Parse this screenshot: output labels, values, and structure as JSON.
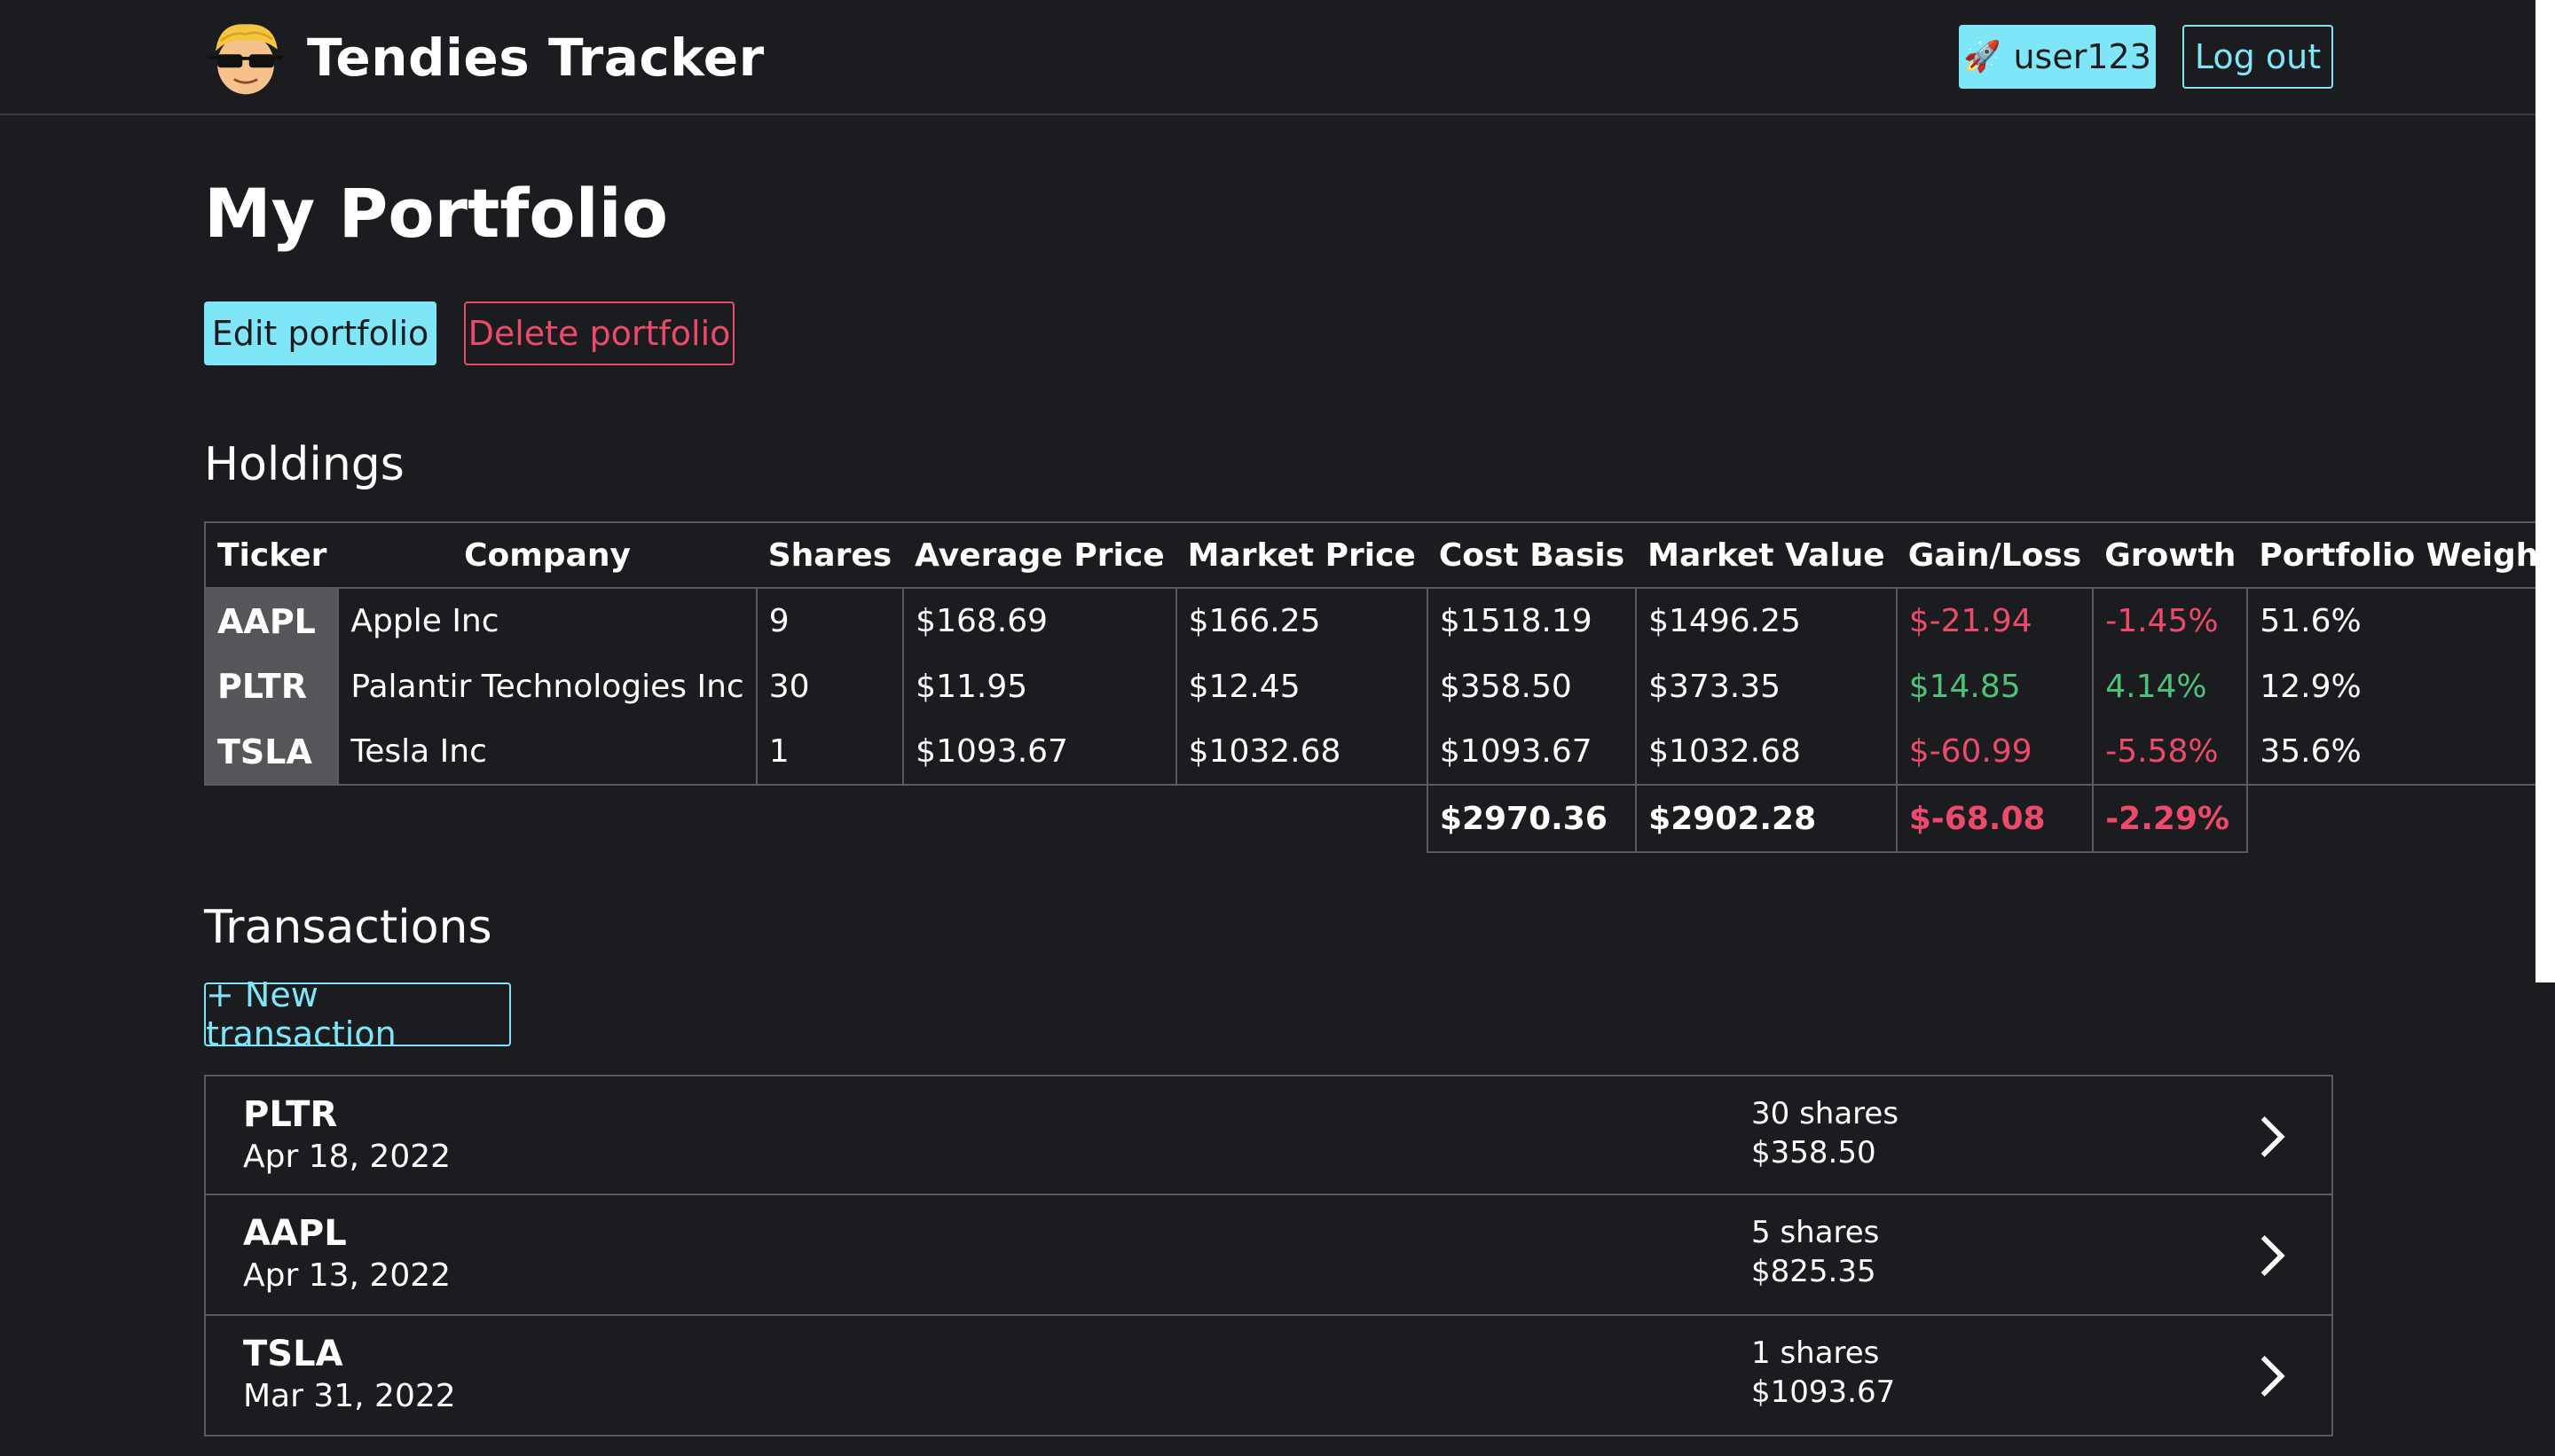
{
  "header": {
    "brand": "Tendies Tracker",
    "logo_icon": "wsb-mascot-icon",
    "user_icon": "rocket-icon",
    "user_label": "user123",
    "logout_label": "Log out"
  },
  "page": {
    "title": "My Portfolio",
    "edit_label": "Edit portfolio",
    "delete_label": "Delete portfolio"
  },
  "holdings": {
    "title": "Holdings",
    "columns": [
      "Ticker",
      "Company",
      "Shares",
      "Average Price",
      "Market Price",
      "Cost Basis",
      "Market Value",
      "Gain/Loss",
      "Growth",
      "Portfolio Weight"
    ],
    "rows": [
      {
        "ticker": "AAPL",
        "company": "Apple Inc",
        "shares": "9",
        "avg_price": "$168.69",
        "market_price": "$166.25",
        "cost_basis": "$1518.19",
        "market_value": "$1496.25",
        "gain_loss": "$-21.94",
        "growth": "-1.45%",
        "weight": "51.6%"
      },
      {
        "ticker": "PLTR",
        "company": "Palantir Technologies Inc",
        "shares": "30",
        "avg_price": "$11.95",
        "market_price": "$12.45",
        "cost_basis": "$358.50",
        "market_value": "$373.35",
        "gain_loss": "$14.85",
        "growth": "4.14%",
        "weight": "12.9%"
      },
      {
        "ticker": "TSLA",
        "company": "Tesla Inc",
        "shares": "1",
        "avg_price": "$1093.67",
        "market_price": "$1032.68",
        "cost_basis": "$1093.67",
        "market_value": "$1032.68",
        "gain_loss": "$-60.99",
        "growth": "-5.58%",
        "weight": "35.6%"
      }
    ],
    "totals": {
      "cost_basis": "$2970.36",
      "market_value": "$2902.28",
      "gain_loss": "$-68.08",
      "growth": "-2.29%"
    }
  },
  "transactions": {
    "title": "Transactions",
    "new_label": "+ New transaction",
    "items": [
      {
        "ticker": "PLTR",
        "date": "Apr 18, 2022",
        "shares": "30 shares",
        "amount": "$358.50"
      },
      {
        "ticker": "AAPL",
        "date": "Apr 13, 2022",
        "shares": "5 shares",
        "amount": "$825.35"
      },
      {
        "ticker": "TSLA",
        "date": "Mar 31, 2022",
        "shares": "1 shares",
        "amount": "$1093.67"
      }
    ]
  },
  "colors": {
    "background": "#1b1c1f",
    "accent": "#7ee6f7",
    "danger": "#ec4a6a",
    "positive": "#4fc27a"
  }
}
